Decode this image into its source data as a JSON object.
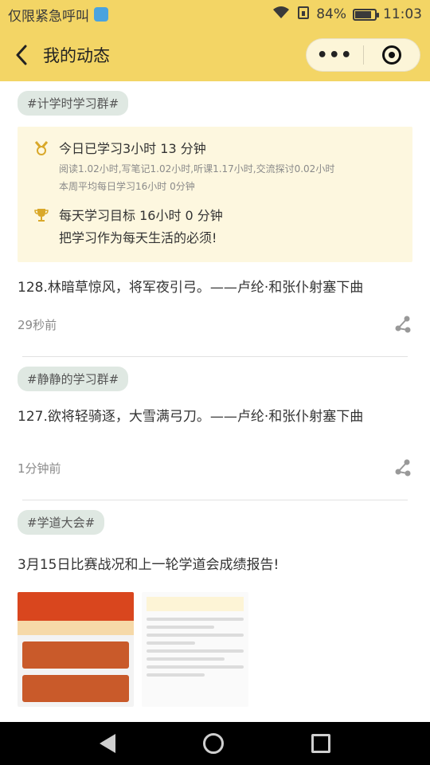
{
  "status_bar": {
    "carrier": "仅限紧急呼叫",
    "battery": "84%",
    "battery_level": 0.84,
    "time": "11:03"
  },
  "header": {
    "title": "我的动态",
    "more_label": "•••"
  },
  "posts": [
    {
      "tag": "#计学时学习群#",
      "stats": {
        "today": "今日已学习3小时 13 分钟",
        "detail": "阅读1.02小时,写笔记1.02小时,听课1.17小时,交流探讨0.02小时",
        "weekly": "本周平均每日学习16小时 0分钟",
        "goal": "每天学习目标 16小时 0 分钟",
        "motto": "把学习作为每天生活的必须!"
      },
      "text": "128.林暗草惊风，将军夜引弓。——卢纶·和张仆射塞下曲",
      "time": "29秒前"
    },
    {
      "tag": "#静静的学习群#",
      "text": "127.欲将轻骑逐，大雪满弓刀。——卢纶·和张仆射塞下曲",
      "time": "1分钟前"
    },
    {
      "tag": "#学道大会#",
      "text": "3月15日比赛战况和上一轮学道会成绩报告!"
    }
  ],
  "colors": {
    "header_bg": "#f3d565",
    "tag_bg": "#dfe8e2",
    "card_bg": "#fdf7df",
    "icon_gold": "#d9a82a"
  },
  "icons": {
    "back": "chevron-left-icon",
    "more": "more-dots-icon",
    "target": "target-icon",
    "medal": "medal-icon",
    "trophy": "trophy-icon",
    "share": "share-icon"
  }
}
